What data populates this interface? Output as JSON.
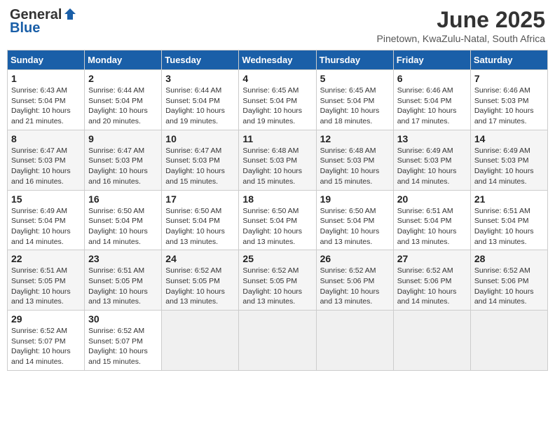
{
  "header": {
    "logo_general": "General",
    "logo_blue": "Blue",
    "month_title": "June 2025",
    "location": "Pinetown, KwaZulu-Natal, South Africa"
  },
  "days_of_week": [
    "Sunday",
    "Monday",
    "Tuesday",
    "Wednesday",
    "Thursday",
    "Friday",
    "Saturday"
  ],
  "weeks": [
    [
      {
        "day": "1",
        "sunrise": "6:43 AM",
        "sunset": "5:04 PM",
        "daylight": "10 hours and 21 minutes."
      },
      {
        "day": "2",
        "sunrise": "6:44 AM",
        "sunset": "5:04 PM",
        "daylight": "10 hours and 20 minutes."
      },
      {
        "day": "3",
        "sunrise": "6:44 AM",
        "sunset": "5:04 PM",
        "daylight": "10 hours and 19 minutes."
      },
      {
        "day": "4",
        "sunrise": "6:45 AM",
        "sunset": "5:04 PM",
        "daylight": "10 hours and 19 minutes."
      },
      {
        "day": "5",
        "sunrise": "6:45 AM",
        "sunset": "5:04 PM",
        "daylight": "10 hours and 18 minutes."
      },
      {
        "day": "6",
        "sunrise": "6:46 AM",
        "sunset": "5:04 PM",
        "daylight": "10 hours and 17 minutes."
      },
      {
        "day": "7",
        "sunrise": "6:46 AM",
        "sunset": "5:03 PM",
        "daylight": "10 hours and 17 minutes."
      }
    ],
    [
      {
        "day": "8",
        "sunrise": "6:47 AM",
        "sunset": "5:03 PM",
        "daylight": "10 hours and 16 minutes."
      },
      {
        "day": "9",
        "sunrise": "6:47 AM",
        "sunset": "5:03 PM",
        "daylight": "10 hours and 16 minutes."
      },
      {
        "day": "10",
        "sunrise": "6:47 AM",
        "sunset": "5:03 PM",
        "daylight": "10 hours and 15 minutes."
      },
      {
        "day": "11",
        "sunrise": "6:48 AM",
        "sunset": "5:03 PM",
        "daylight": "10 hours and 15 minutes."
      },
      {
        "day": "12",
        "sunrise": "6:48 AM",
        "sunset": "5:03 PM",
        "daylight": "10 hours and 15 minutes."
      },
      {
        "day": "13",
        "sunrise": "6:49 AM",
        "sunset": "5:03 PM",
        "daylight": "10 hours and 14 minutes."
      },
      {
        "day": "14",
        "sunrise": "6:49 AM",
        "sunset": "5:03 PM",
        "daylight": "10 hours and 14 minutes."
      }
    ],
    [
      {
        "day": "15",
        "sunrise": "6:49 AM",
        "sunset": "5:04 PM",
        "daylight": "10 hours and 14 minutes."
      },
      {
        "day": "16",
        "sunrise": "6:50 AM",
        "sunset": "5:04 PM",
        "daylight": "10 hours and 14 minutes."
      },
      {
        "day": "17",
        "sunrise": "6:50 AM",
        "sunset": "5:04 PM",
        "daylight": "10 hours and 13 minutes."
      },
      {
        "day": "18",
        "sunrise": "6:50 AM",
        "sunset": "5:04 PM",
        "daylight": "10 hours and 13 minutes."
      },
      {
        "day": "19",
        "sunrise": "6:50 AM",
        "sunset": "5:04 PM",
        "daylight": "10 hours and 13 minutes."
      },
      {
        "day": "20",
        "sunrise": "6:51 AM",
        "sunset": "5:04 PM",
        "daylight": "10 hours and 13 minutes."
      },
      {
        "day": "21",
        "sunrise": "6:51 AM",
        "sunset": "5:04 PM",
        "daylight": "10 hours and 13 minutes."
      }
    ],
    [
      {
        "day": "22",
        "sunrise": "6:51 AM",
        "sunset": "5:05 PM",
        "daylight": "10 hours and 13 minutes."
      },
      {
        "day": "23",
        "sunrise": "6:51 AM",
        "sunset": "5:05 PM",
        "daylight": "10 hours and 13 minutes."
      },
      {
        "day": "24",
        "sunrise": "6:52 AM",
        "sunset": "5:05 PM",
        "daylight": "10 hours and 13 minutes."
      },
      {
        "day": "25",
        "sunrise": "6:52 AM",
        "sunset": "5:05 PM",
        "daylight": "10 hours and 13 minutes."
      },
      {
        "day": "26",
        "sunrise": "6:52 AM",
        "sunset": "5:06 PM",
        "daylight": "10 hours and 13 minutes."
      },
      {
        "day": "27",
        "sunrise": "6:52 AM",
        "sunset": "5:06 PM",
        "daylight": "10 hours and 14 minutes."
      },
      {
        "day": "28",
        "sunrise": "6:52 AM",
        "sunset": "5:06 PM",
        "daylight": "10 hours and 14 minutes."
      }
    ],
    [
      {
        "day": "29",
        "sunrise": "6:52 AM",
        "sunset": "5:07 PM",
        "daylight": "10 hours and 14 minutes."
      },
      {
        "day": "30",
        "sunrise": "6:52 AM",
        "sunset": "5:07 PM",
        "daylight": "10 hours and 15 minutes."
      },
      null,
      null,
      null,
      null,
      null
    ]
  ]
}
